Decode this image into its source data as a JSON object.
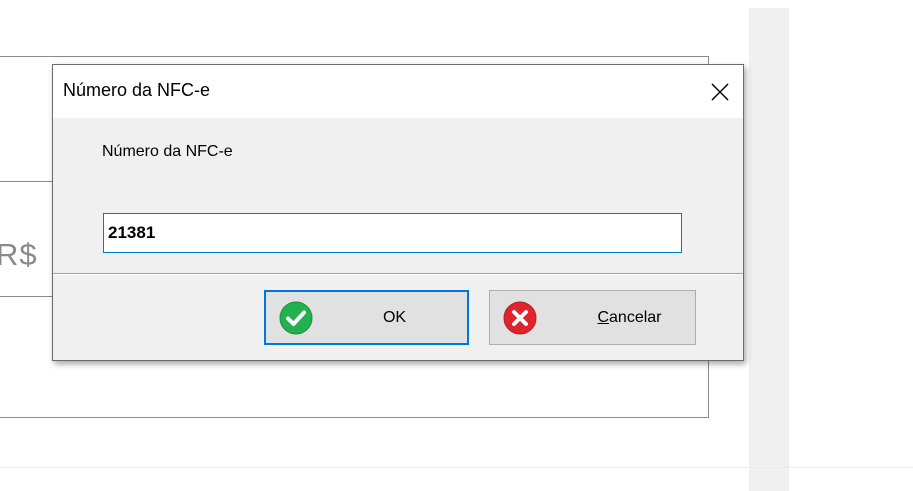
{
  "background": {
    "currency_symbol": "R$"
  },
  "dialog": {
    "title": "Número da NFC-e",
    "close_icon": "close-icon",
    "prompt_label": "Número da NFC-e",
    "input_value": "21381",
    "buttons": {
      "ok": {
        "label": "OK",
        "icon": "check-circle-icon",
        "icon_color": "#22b14c"
      },
      "cancel": {
        "label_mnemonic": "C",
        "label_rest": "ancelar",
        "icon": "x-circle-icon",
        "icon_color": "#e0242c"
      }
    },
    "accent_color": "#0078d7"
  }
}
